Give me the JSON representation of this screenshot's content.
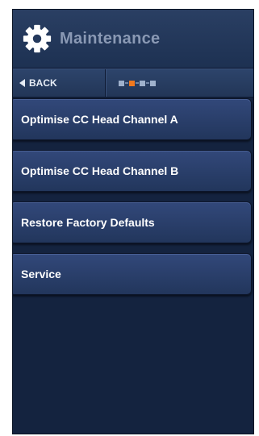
{
  "header": {
    "title": "Maintenance",
    "icon": "gear-icon"
  },
  "navbar": {
    "back_label": "BACK",
    "pager": {
      "total_pages": 4,
      "current_page": 2
    }
  },
  "menu": {
    "items": [
      {
        "label": "Optimise CC Head Channel A"
      },
      {
        "label": "Optimise CC Head Channel B"
      },
      {
        "label": "Restore Factory Defaults"
      },
      {
        "label": "Service"
      }
    ]
  },
  "colors": {
    "accent": "#f0781e",
    "background": "#14233f"
  }
}
